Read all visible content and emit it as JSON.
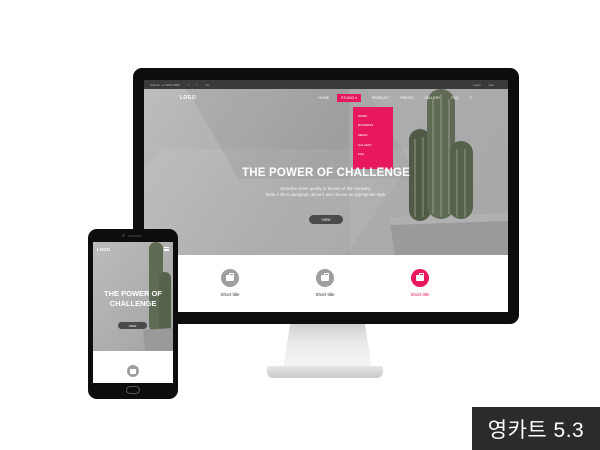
{
  "desktop": {
    "topbar": {
      "contact": "Call Us: +1 0000 0000",
      "social_facebook": "f",
      "social_twitter": "t",
      "social_google": "G+",
      "login": "Login",
      "join": "Join"
    },
    "logo": "LOGO",
    "nav": [
      "HOME",
      "STUDIO",
      "PRODUCT",
      "PRICES",
      "GALLERY",
      "FAQ"
    ],
    "active_nav_label": "STUDIO ▾",
    "dropdown": [
      "WORK",
      "BUSINESS",
      "MEDIA",
      "GALLERY",
      "FAQ"
    ],
    "hero": {
      "title": "THE POWER OF CHALLENGE",
      "desc_line1": "Describe some quality or feature of the company.",
      "desc_line2": "Write a short paragraph about it and choose an appropriate style.",
      "button": "VIEW"
    },
    "features": [
      {
        "label": "Short title",
        "highlight": false
      },
      {
        "label": "Short title",
        "highlight": false
      },
      {
        "label": "Short title",
        "highlight": true
      }
    ]
  },
  "mobile": {
    "logo": "LOGO",
    "title_line1": "THE POWER OF",
    "title_line2": "CHALLENGE",
    "button": "VIEW"
  },
  "badge": "영카트 5.3",
  "colors": {
    "accent": "#e8185f",
    "device_frame": "#0d0d0d",
    "hero_gray": "#a8a8a8",
    "badge_bg": "#2b2b2b"
  },
  "icons": {
    "search": "search-icon",
    "feature": "briefcase-icon",
    "menu": "hamburger-menu-icon"
  }
}
